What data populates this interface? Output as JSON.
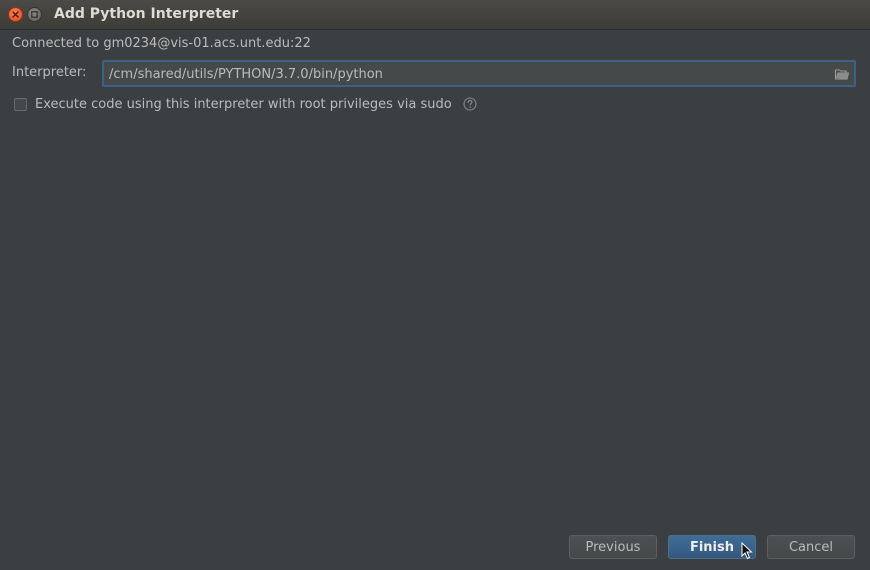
{
  "window": {
    "title": "Add Python Interpreter"
  },
  "connection": {
    "text": "Connected to gm0234@vis-01.acs.unt.edu:22"
  },
  "interpreter": {
    "label": "Interpreter:",
    "value": "/cm/shared/utils/PYTHON/3.7.0/bin/python",
    "browse_icon": "folder-open-icon"
  },
  "sudo_option": {
    "label": "Execute code using this interpreter with root privileges via sudo",
    "checked": false,
    "help_icon": "question-mark-icon"
  },
  "buttons": {
    "previous_label": "Previous",
    "finish_label": "Finish",
    "cancel_label": "Cancel"
  },
  "colors": {
    "background": "#3c3f41",
    "accent": "#365880",
    "focus_border": "#3d6185",
    "text": "#bbbbbb"
  }
}
